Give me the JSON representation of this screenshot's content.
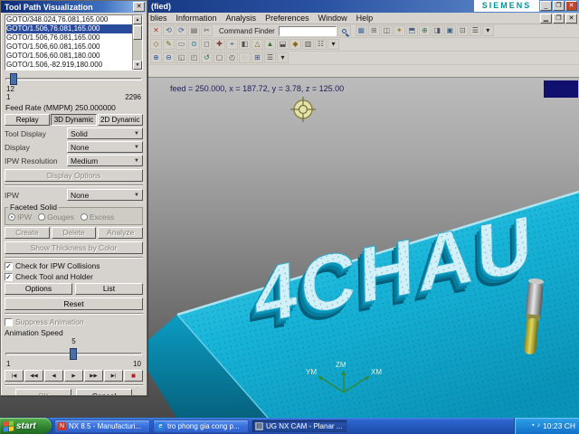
{
  "colors": {
    "accent_navy": "#0a246a",
    "model_cyan": "#17b4d8",
    "taskbar_blue": "#2458bc",
    "start_green": "#2f8230",
    "siemens_teal": "#00929e",
    "selection_blue": "#2a4a9c"
  },
  "window": {
    "title_fragment": "(fied)",
    "brand": "SIEMENS",
    "controls": {
      "minimize": "_",
      "maximize": "❐",
      "close": "✕"
    },
    "mdi": {
      "minimize": "▁",
      "restore": "❐",
      "close": "✕"
    },
    "menus": [
      "blies",
      "Information",
      "Analysis",
      "Preferences",
      "Window",
      "Help"
    ]
  },
  "toolbars": {
    "command_finder_label": "Command Finder",
    "row1a": [
      {
        "g": "✕",
        "c": "#b03a2e"
      },
      {
        "g": "⟲",
        "c": "#3a5f9e"
      },
      {
        "g": "⟳",
        "c": "#3a5f9e"
      },
      {
        "g": "▤",
        "c": "#555555"
      },
      {
        "g": "✂",
        "c": "#555555"
      }
    ],
    "row1b": [
      {
        "g": "▦",
        "c": "#4a6ea0"
      },
      {
        "g": "⊞",
        "c": "#6a6a6a"
      },
      {
        "g": "◫",
        "c": "#555555"
      },
      {
        "g": "✦",
        "c": "#a07c20"
      },
      {
        "g": "⬒",
        "c": "#4f5f7f"
      },
      {
        "g": "⊕",
        "c": "#2f7a44"
      },
      {
        "g": "◨",
        "c": "#555566"
      },
      {
        "g": "▣",
        "c": "#3f5f83"
      },
      {
        "g": "⊡",
        "c": "#555555"
      },
      {
        "g": "☰",
        "c": "#444444"
      },
      {
        "g": "▾",
        "c": "#222222"
      }
    ],
    "row2": [
      {
        "g": "◇",
        "c": "#7a5a2a"
      },
      {
        "g": "✎",
        "c": "#6f6f20"
      },
      {
        "g": "▭",
        "c": "#47597a"
      },
      {
        "g": "⊙",
        "c": "#2a6a8a"
      },
      {
        "g": "◻",
        "c": "#555555"
      },
      {
        "g": "✚",
        "c": "#7a3a3a"
      },
      {
        "g": "⌖",
        "c": "#3a5a8a"
      },
      {
        "g": "◧",
        "c": "#555555"
      },
      {
        "g": "△",
        "c": "#7a6a2a"
      },
      {
        "g": "▲",
        "c": "#2f7a2f"
      },
      {
        "g": "⬓",
        "c": "#555555"
      },
      {
        "g": "◆",
        "c": "#8a6a1a"
      },
      {
        "g": "▥",
        "c": "#555555"
      },
      {
        "g": "☷",
        "c": "#555555"
      },
      {
        "g": "▾",
        "c": "#222222"
      }
    ],
    "row3": [
      {
        "g": "⊕",
        "c": "#3a5a8a"
      },
      {
        "g": "⊖",
        "c": "#3a5a8a"
      },
      {
        "g": "◱",
        "c": "#555555"
      },
      {
        "g": "◰",
        "c": "#555555"
      },
      {
        "g": "↺",
        "c": "#2a6a3a"
      },
      {
        "g": "▢",
        "c": "#555555"
      },
      {
        "g": "◴",
        "c": "#555555"
      },
      {
        "g": "◌",
        "c": "#777777"
      },
      {
        "g": "⊞",
        "c": "#445577"
      },
      {
        "g": "☰",
        "c": "#444444"
      },
      {
        "g": "▾",
        "c": "#222222"
      }
    ]
  },
  "statusbar": {
    "text": "feed = 250.000, x = 187.72, y = 3.78, z = 125.00"
  },
  "dialog": {
    "title": "Tool Path Visualization",
    "close_glyph": "✕",
    "goto_lines": [
      "GOTO/348.024,76.081,165.000",
      "GOTO/1.506,76.081,165.000",
      "GOTO/1.506,76.081,165.000",
      "GOTO/1.506,60.081,165.000",
      "GOTO/1.506,60.081,180.000",
      "GOTO/1.506,-82.919,180.000"
    ],
    "progress": {
      "current": "12",
      "min": "1",
      "max": "2296"
    },
    "feed_rate": "Feed Rate (MMPM) 250.000000",
    "tabs": [
      "Replay",
      "3D Dynamic",
      "2D Dynamic"
    ],
    "fields": [
      {
        "label": "Tool Display",
        "value": "Solid"
      },
      {
        "label": "Display",
        "value": "None"
      },
      {
        "label": "IPW Resolution",
        "value": "Medium"
      }
    ],
    "ipw_label": "IPW",
    "ipw_value": "None",
    "faceted": {
      "title": "Faceted Solid",
      "radios": [
        "IPW",
        "Gouges",
        "Excess"
      ]
    },
    "buttons": {
      "display_options": "Display Options",
      "create": "Create",
      "delete": "Delete",
      "analyze": "Analyze",
      "thickness": "Show Thickness by Color",
      "options": "Options",
      "list": "List",
      "reset": "Reset",
      "ok": "OK",
      "cancel": "Cancel"
    },
    "checks": {
      "ipw": "Check for IPW Collisions",
      "tool": "Check Tool and Holder",
      "suppress": "Suppress Animation"
    },
    "anim": {
      "label": "Animation Speed",
      "value": "5",
      "min": "1",
      "max": "10"
    },
    "playback": [
      "|◀",
      "◀◀",
      "◀",
      "▶",
      "▶▶",
      "▶|",
      "■"
    ],
    "icons": {
      "dropdown": "▼",
      "up": "▲",
      "down": "▼",
      "check": "✓"
    }
  },
  "viewport": {
    "model_text": "4CHAU",
    "triad": {
      "x": "XM",
      "y": "YM",
      "z": "ZM"
    }
  },
  "taskbar": {
    "start_label": "start",
    "tasks": [
      {
        "label": "NX 8.5 - Manufacturi...",
        "icon": "N"
      },
      {
        "label": "tro phong gia cong p...",
        "icon": "e"
      },
      {
        "label": "UG NX CAM - Planar ...",
        "icon": "▤"
      }
    ],
    "tray_icons": [
      "▪",
      "♪"
    ],
    "tray_time": "10:23 CH"
  }
}
